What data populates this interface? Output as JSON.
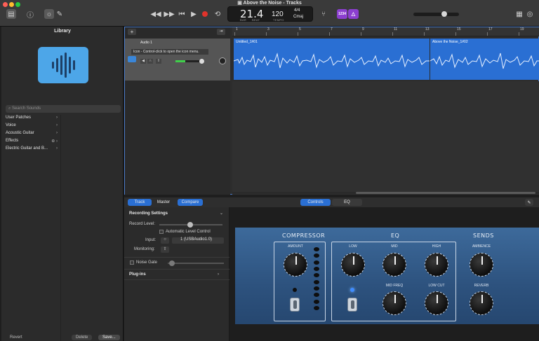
{
  "window": {
    "title": "Above the Noise - Tracks"
  },
  "toolbar": {
    "lcd": {
      "bar": "21.4",
      "bar_caption": "BAR",
      "beat_caption": "BEAT",
      "tempo": "120",
      "tempo_caption": "TEMPO",
      "time_sig": "4/4",
      "key": "Cmaj"
    },
    "count_in_label": "1234"
  },
  "library": {
    "title": "Library",
    "search_placeholder": "Search Sounds",
    "items": [
      {
        "label": "User Patches"
      },
      {
        "label": "Voice"
      },
      {
        "label": "Acoustic Guitar"
      },
      {
        "label": "Effects"
      },
      {
        "label": "Electric Guitar and B..."
      }
    ],
    "revert_label": "Revert",
    "delete_label": "Delete",
    "save_label": "Save..."
  },
  "tracks": {
    "track_name": "Audio 1",
    "tooltip": "Icon - Control-click to open the icon menu.",
    "ruler_ticks": [
      "1",
      "3",
      "5",
      "7",
      "9",
      "11",
      "13",
      "15",
      "17",
      "19"
    ],
    "regions": [
      {
        "label": "Untitled_1#01"
      },
      {
        "label": "Above the Noise_1#02"
      }
    ]
  },
  "smart_controls": {
    "tabs": {
      "track": "Track",
      "master": "Master",
      "compare": "Compare"
    },
    "view_tabs": {
      "controls": "Controls",
      "eq": "EQ"
    },
    "recording_settings": "Recording Settings",
    "record_level": "Record Level:",
    "auto_level": "Automatic Level Control",
    "input_label": "Input:",
    "input_value": "1 (USBAudio1.0)",
    "monitoring_label": "Monitoring:",
    "noise_gate": "Noise Gate",
    "plugins": "Plug-ins"
  },
  "plugin": {
    "compressor": "COMPRESSOR",
    "eq": "EQ",
    "sends": "SENDS",
    "amount": "AMOUNT",
    "low": "LOW",
    "mid": "MID",
    "high": "HIGH",
    "mid_freq": "MID FREQ",
    "low_cut": "LOW CUT",
    "ambience": "AMBIENCE",
    "reverb": "REVERB"
  },
  "colors": {
    "accent": "#2a6fd3",
    "record": "#e0332b",
    "purple": "#8c3fd0",
    "plugin_bg": "#2f5581"
  }
}
